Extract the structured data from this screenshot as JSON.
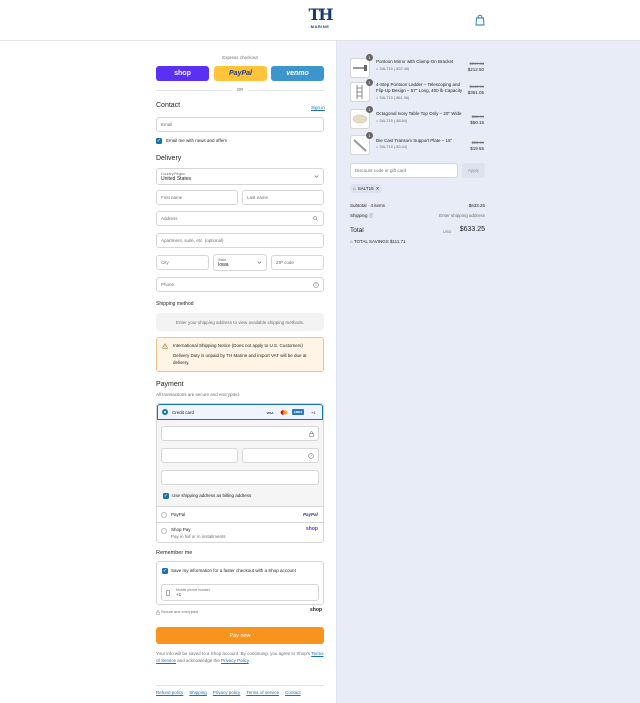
{
  "brand": {
    "logo_mark": "TH",
    "logo_word": "MARINE"
  },
  "express": {
    "label": "Express checkout",
    "shop": "shop",
    "paypal": "PayPal",
    "venmo": "venmo",
    "or": "OR"
  },
  "contact": {
    "heading": "Contact",
    "sign_in": "Sign in",
    "email_placeholder": "Email",
    "news_label": "Email me with news and offers"
  },
  "delivery": {
    "heading": "Delivery",
    "country_label": "Country/Region",
    "country_value": "United States",
    "first_name": "First name",
    "last_name": "Last name",
    "address": "Address",
    "apartment": "Apartment, suite, etc. (optional)",
    "city": "City",
    "state_label": "State",
    "state_value": "Iowa",
    "zip": "ZIP code",
    "phone": "Phone"
  },
  "shipping": {
    "heading": "Shipping method",
    "message": "Enter your shipping address to view available shipping methods."
  },
  "notice": {
    "title": "International Shipping Notice (Does not apply to U.S. Customers)",
    "body": "Delivery Duty is unpaid by TH Marine and import VAT will be due at delivery."
  },
  "payment": {
    "heading": "Payment",
    "subtitle": "All transactions are secure and encrypted.",
    "credit_card": "Credit card",
    "more_cards": "+1",
    "billing_same": "Use shipping address as billing address",
    "paypal": "PayPal",
    "shop_pay": "Shop Pay",
    "shop_pay_sub": "Pay in full or in installments",
    "shop_logo": "shop",
    "cards": [
      "VISA",
      "MC",
      "AMEX"
    ]
  },
  "remember": {
    "heading": "Remember me",
    "save_label": "Save my information for a faster checkout with a Shop account",
    "mobile_label": "Mobile phone number",
    "mobile_value": "+1",
    "secure": "Secure and encrypted",
    "shop": "shop"
  },
  "pay_now": "Pay now",
  "legal": {
    "prefix": "Your info will be saved to a Shop account. By continuing, you agree to Shop's ",
    "terms": "Terms of Service",
    "mid": " and acknowledge the ",
    "privacy": "Privacy Policy",
    "suffix": "."
  },
  "footer_links": [
    "Refund policy",
    "Shipping",
    "Privacy policy",
    "Terms of service",
    "Contact"
  ],
  "cart": {
    "items": [
      {
        "qty": "1",
        "title": "Pontoon Mirror with Clamp-On Bracket",
        "discount": "SALT15 (-$37.48)",
        "original": "$249.88",
        "price": "$212.50"
      },
      {
        "qty": "1",
        "title": "4-Step Pontoon Ladder – Telescoping and Flip-Up Design – 57\" Long, 400 lb Capacity",
        "discount": "SALT15 (-$61.96)",
        "original": "$412.99",
        "price": "$351.05"
      },
      {
        "qty": "1",
        "title": "Octagonal Ivory Table Top Only – 20\" Wide",
        "discount": "SALT15 (-$8.84)",
        "original": "$58.99",
        "price": "$50.15"
      },
      {
        "qty": "1",
        "title": "Die Cast Transom Support Plate – 15\"",
        "discount": "SALT15 (-$3.44)",
        "original": "$22.99",
        "price": "$19.55"
      }
    ],
    "discount_placeholder": "Discount code or gift card",
    "apply": "Apply",
    "code": "SALT15",
    "subtotal_label": "Subtotal · 4 items",
    "subtotal": "$633.25",
    "shipping_label": "Shipping",
    "shipping_value": "Enter shipping address",
    "total_label": "Total",
    "currency": "USD",
    "total": "$633.25",
    "savings_label": "TOTAL SAVINGS",
    "savings": "$111.71"
  },
  "colors": {
    "shop": "#5a31f4",
    "paypal": "#ffc439",
    "venmo": "#3d95ce",
    "pay_now": "#f7941d",
    "link": "#1773b0",
    "summary_bg": "#e8ecf6"
  }
}
